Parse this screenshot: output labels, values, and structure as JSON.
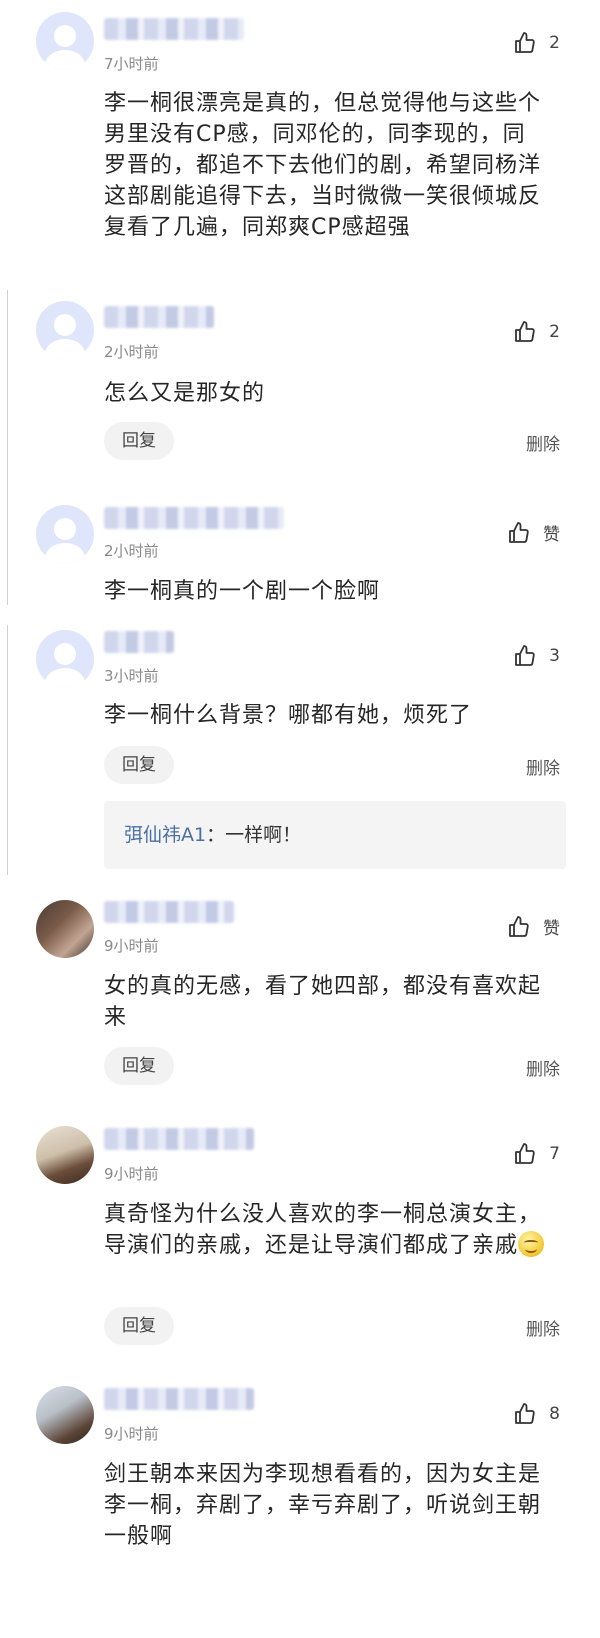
{
  "comments": [
    {
      "time": "7小时前",
      "likes": "2",
      "text": "李一桐很漂亮是真的，但总觉得他与这些个男里没有CP感，同邓伦的，同李现的，同罗晋的，都追不下去他们的剧，希望同杨洋这部剧能追得下去，当时微微一笑很倾城反复看了几遍，同郑爽CP感超强",
      "avatar": "default-avatar"
    },
    {
      "time": "2小时前",
      "likes": "2",
      "text": "怎么又是那女的",
      "reply_label": "回复",
      "delete_label": "删除",
      "avatar": "default-avatar"
    },
    {
      "time": "2小时前",
      "likes": "赞",
      "text": "李一桐真的一个剧一个脸啊",
      "avatar": "default-avatar"
    },
    {
      "time": "3小时前",
      "likes": "3",
      "text": "李一桐什么背景？哪都有她，烦死了",
      "reply_label": "回复",
      "delete_label": "删除",
      "avatar": "default-avatar",
      "subreply": {
        "author": "弭仙祎A1",
        "sep": "：",
        "text": "一样啊！"
      }
    },
    {
      "time": "9小时前",
      "likes": "赞",
      "text": "女的真的无感，看了她四部，都没有喜欢起来",
      "reply_label": "回复",
      "delete_label": "删除",
      "avatar": "photo-avatar"
    },
    {
      "time": "9小时前",
      "likes": "7",
      "text": "真奇怪为什么没人喜欢的李一桐总演女主，导演们的亲戚，还是让导演们都成了亲戚",
      "emoji": "smile-emoji",
      "reply_label": "回复",
      "delete_label": "删除",
      "avatar": "photo-avatar"
    },
    {
      "time": "9小时前",
      "likes": "8",
      "text": "剑王朝本来因为李现想看看的，因为女主是李一桐，弃剧了，幸亏弃剧了，听说剑王朝一般啊",
      "avatar": "photo-avatar"
    }
  ],
  "icons": {
    "like": "thumbs-up-icon"
  },
  "colors": {
    "accent": "#4a6fa5",
    "reply_bg": "#f2f2f2",
    "subreply_bg": "#f4f4f5",
    "avatar_default": "#dfe5fb"
  }
}
